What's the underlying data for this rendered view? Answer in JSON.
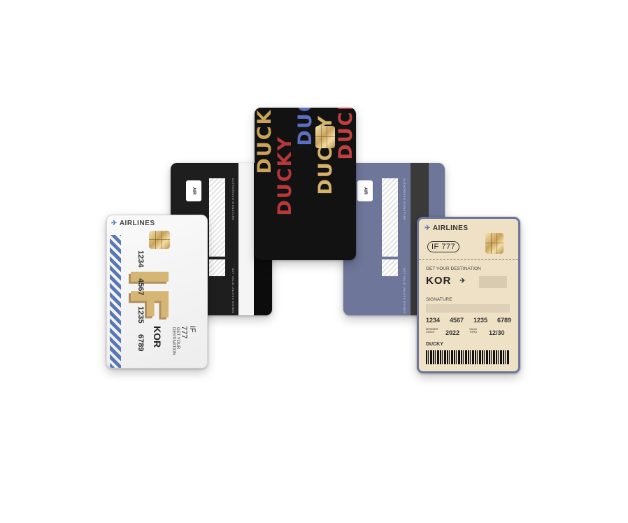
{
  "scene": {
    "alt": ""
  },
  "back_card_logo": "AIR",
  "back_card_auth_label": "AUTHORISED SIGNATURE",
  "back_card_not_valid": "NOT VALID UNLESS SIGNED",
  "front_card_brand": "AIRLINES",
  "front_card_flight": "IF 777",
  "front_card_big_letters": "IF",
  "front_card_destination_label": "GET YOUR DESTINATION",
  "front_card_destination": "KOR",
  "front_card_signature_label": "SIGNATURE",
  "front_card_number": [
    "1234",
    "4567",
    "1235",
    "6789"
  ],
  "front_card_member_label": "MEMBER SINCE",
  "front_card_member_year": "2022",
  "front_card_valid_label": "VALID THRU",
  "front_card_expiry": "12/30",
  "front_card_holder": "DUCKY",
  "ducky_word": "DUCKY",
  "colors": {
    "gold": "#d9c49a",
    "navy_card": "#6c7496",
    "black_card": "#1a1a1a",
    "beige_card": "#efe2c8",
    "ducky_red": "#c23a3a",
    "ducky_blue": "#5a74c6"
  }
}
